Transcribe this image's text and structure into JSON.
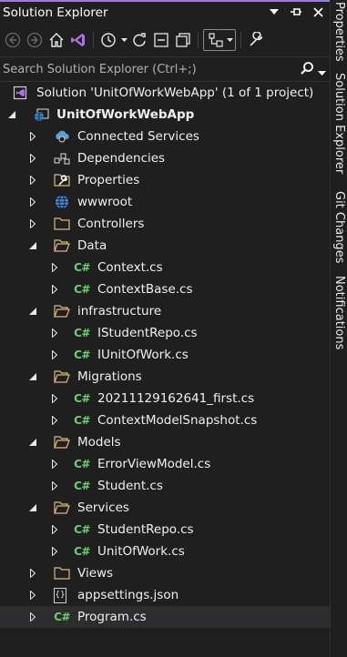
{
  "titlebar": {
    "title": "Solution Explorer",
    "buttons": [
      "dropdown-icon",
      "pin-icon",
      "close-icon"
    ]
  },
  "toolbar": {
    "items": [
      "back-icon",
      "forward-icon",
      "home-icon",
      "vs-switch-view-icon",
      "pending-changes-filter-icon",
      "sync-icon",
      "collapse-all-icon",
      "show-all-files-icon",
      "preview-icon",
      "properties-wrench-icon"
    ]
  },
  "search": {
    "placeholder": "Search Solution Explorer (Ctrl+;)"
  },
  "tree": {
    "solution": "Solution 'UnitOfWorkWebApp' (1 of 1 project)",
    "project": "UnitOfWorkWebApp",
    "connected_services": "Connected Services",
    "dependencies": "Dependencies",
    "properties": "Properties",
    "wwwroot": "wwwroot",
    "controllers": "Controllers",
    "data": "Data",
    "context": "Context.cs",
    "context_base": "ContextBase.cs",
    "infrastructure": "infrastructure",
    "istudentrepo": "IStudentRepo.cs",
    "iunitofwork": "IUnitOfWork.cs",
    "migrations": "Migrations",
    "migration_first": "20211129162641_first.cs",
    "snapshot": "ContextModelSnapshot.cs",
    "models": "Models",
    "errorviewmodel": "ErrorViewModel.cs",
    "student": "Student.cs",
    "services": "Services",
    "studentrepo": "StudentRepo.cs",
    "unitofwork": "UnitOfWork.cs",
    "views": "Views",
    "appsettings": "appsettings.json",
    "program": "Program.cs",
    "cs_badge": "C#",
    "json_badge": "{}"
  },
  "side_tabs": [
    "Properties",
    "Solution Explorer",
    "Git Changes",
    "Notifications"
  ],
  "colors": {
    "background": "#1f1f1f",
    "accent": "#9b7be0",
    "cs_green": "#6fcf6f",
    "folder": "#dcb67a",
    "selected_row": "#2d2d30"
  }
}
